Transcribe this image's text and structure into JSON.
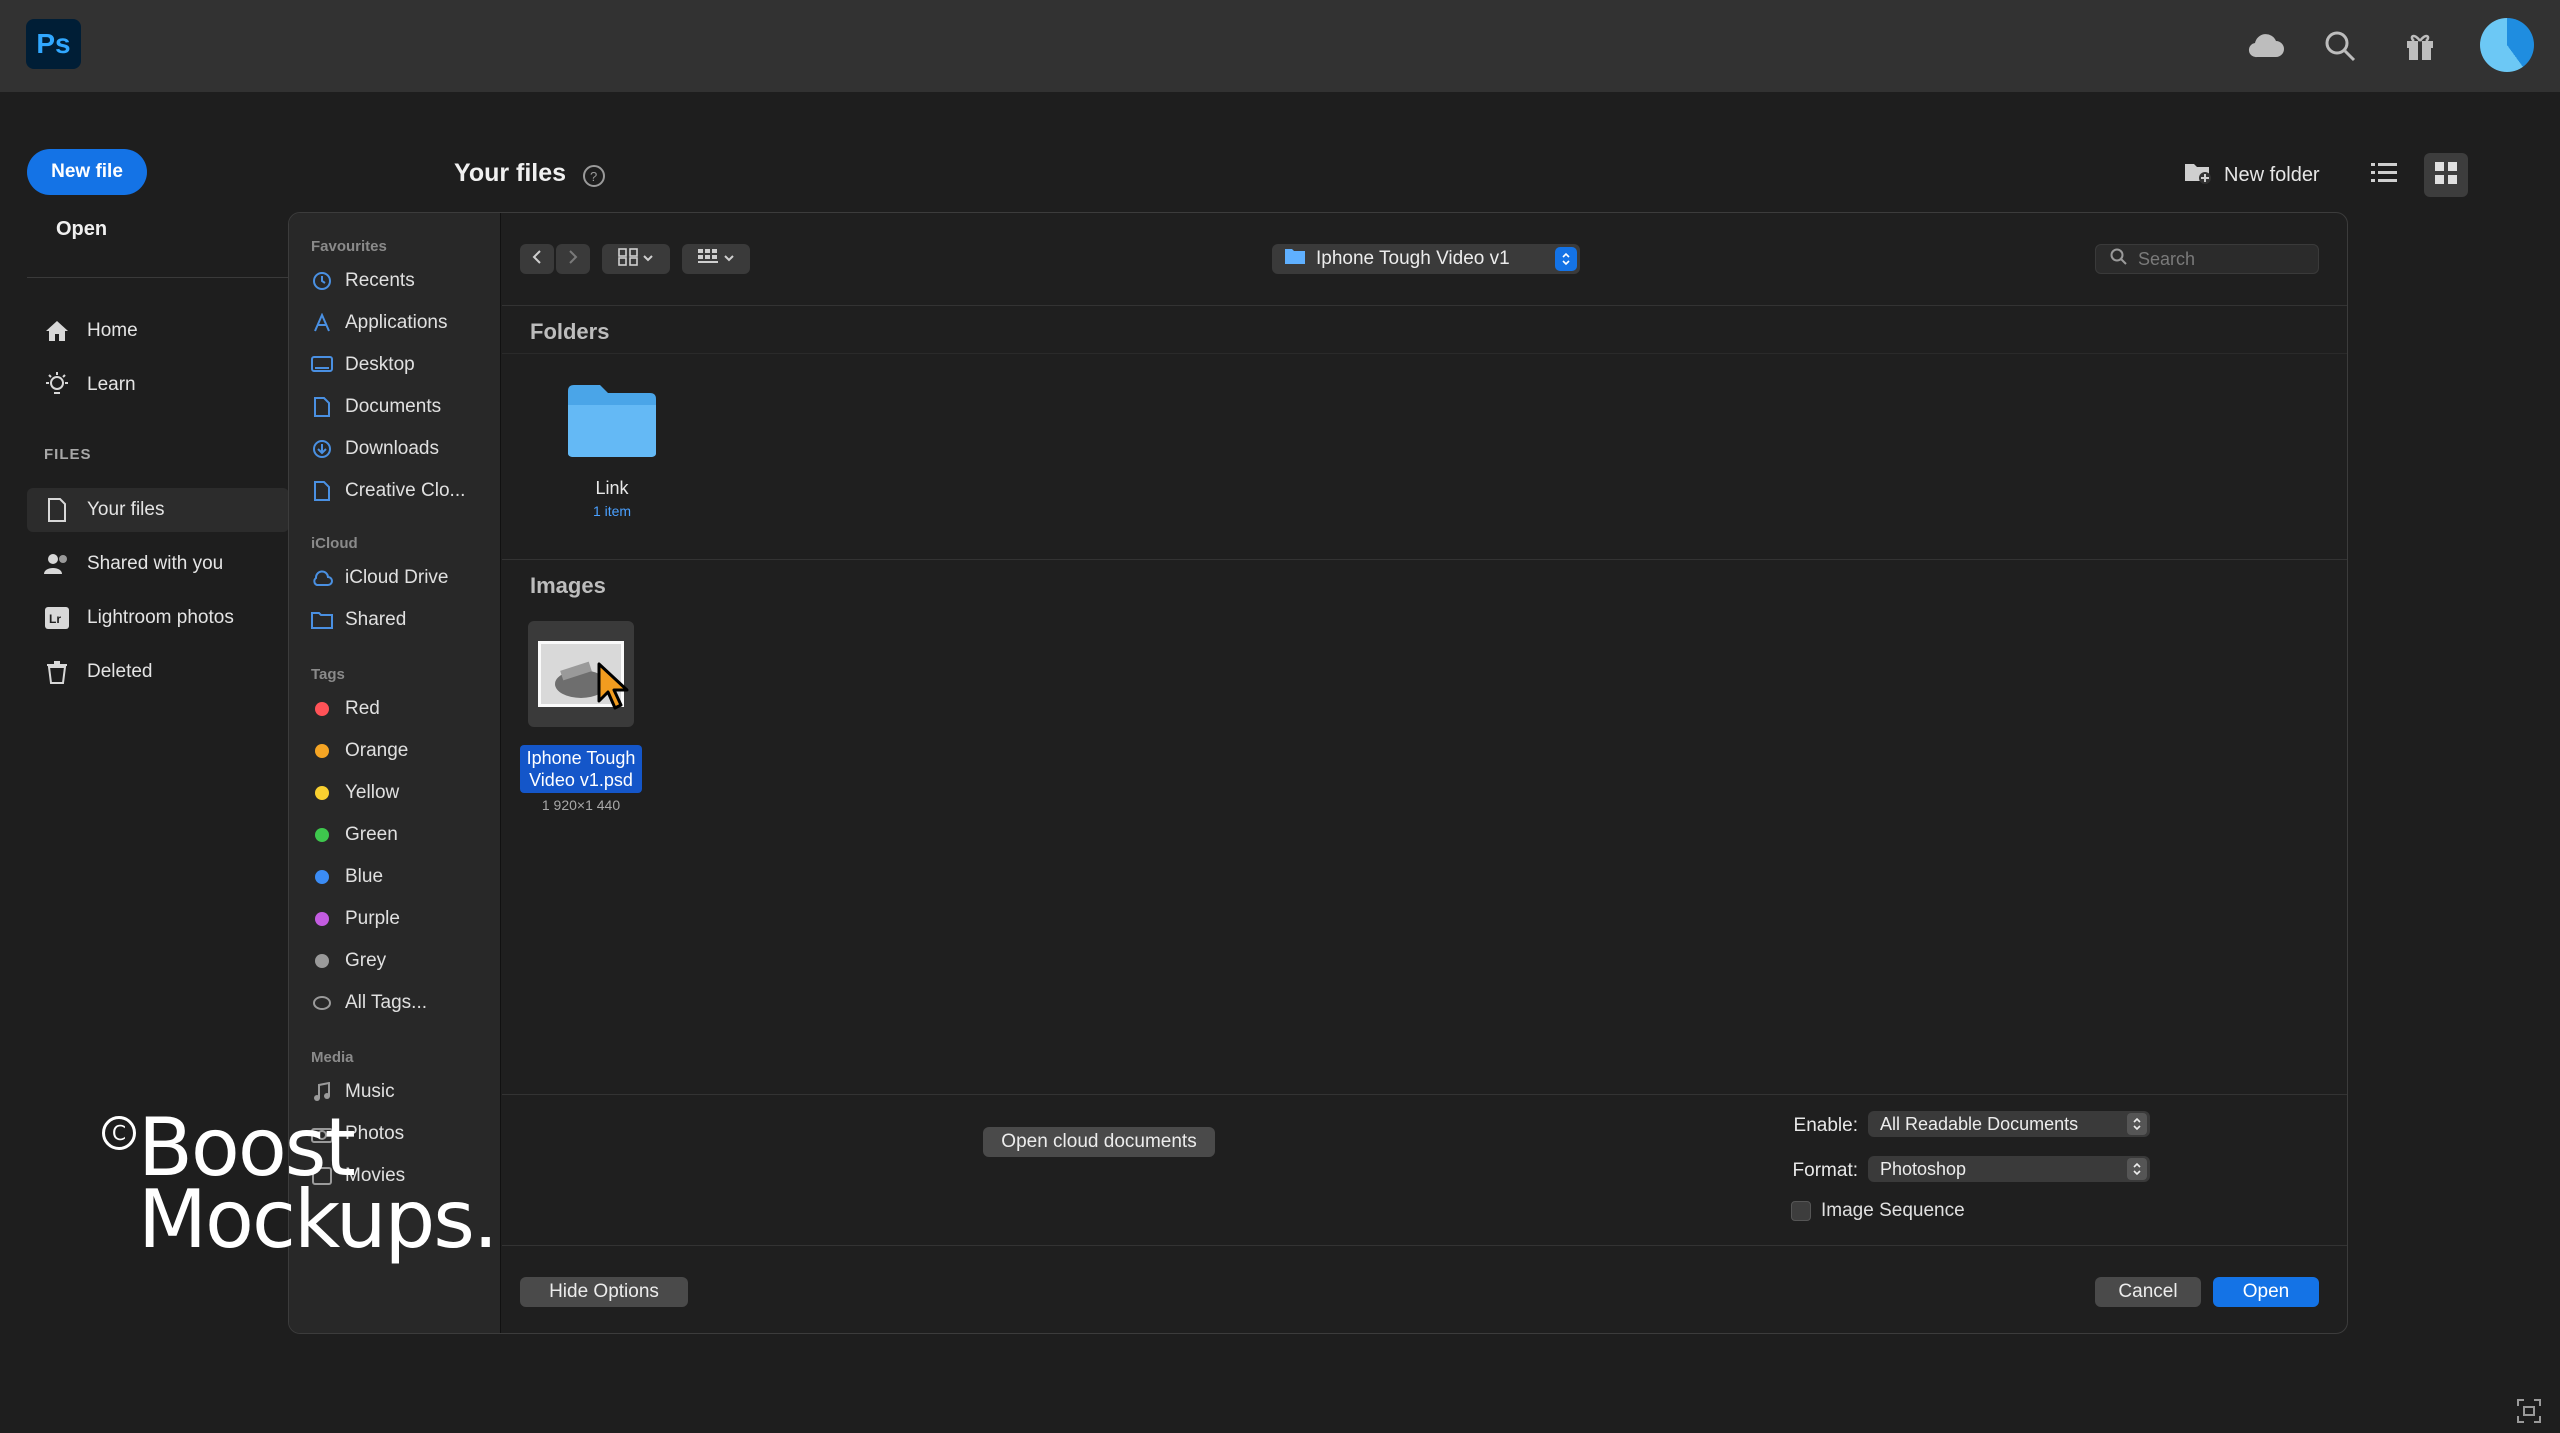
{
  "app": {
    "logo_text": "Ps",
    "brand_color": "#31a8ff",
    "accent_color": "#1473e6"
  },
  "topbar": {
    "icons": [
      "cloud-icon",
      "search-icon",
      "gift-icon",
      "avatar"
    ]
  },
  "sidebar": {
    "new_file_label": "New file",
    "open_label": "Open",
    "nav": [
      {
        "label": "Home",
        "icon": "home-icon"
      },
      {
        "label": "Learn",
        "icon": "lightbulb-icon"
      }
    ],
    "files_heading": "FILES",
    "files": [
      {
        "label": "Your files",
        "icon": "file-icon",
        "active": true
      },
      {
        "label": "Shared with you",
        "icon": "people-icon"
      },
      {
        "label": "Lightroom photos",
        "icon": "lightroom-icon"
      },
      {
        "label": "Deleted",
        "icon": "trash-icon"
      }
    ]
  },
  "header": {
    "title": "Your files",
    "new_folder_label": "New folder"
  },
  "dialog": {
    "sidebar": {
      "favourites_heading": "Favourites",
      "favourites": [
        "Recents",
        "Applications",
        "Desktop",
        "Documents",
        "Downloads",
        "Creative Clo..."
      ],
      "icloud_heading": "iCloud",
      "icloud": [
        "iCloud Drive",
        "Shared"
      ],
      "tags_heading": "Tags",
      "tags": [
        {
          "label": "Red",
          "color": "#ff5257"
        },
        {
          "label": "Orange",
          "color": "#f5a524"
        },
        {
          "label": "Yellow",
          "color": "#f9d030"
        },
        {
          "label": "Green",
          "color": "#3ec74d"
        },
        {
          "label": "Blue",
          "color": "#3b8cf5"
        },
        {
          "label": "Purple",
          "color": "#c35ce0"
        },
        {
          "label": "Grey",
          "color": "#9a9a9a"
        }
      ],
      "all_tags_label": "All Tags...",
      "media_heading": "Media",
      "media": [
        "Music",
        "Photos",
        "Movies"
      ]
    },
    "path_label": "Iphone Tough Video v1",
    "search_placeholder": "Search",
    "folders_heading": "Folders",
    "folder": {
      "name": "Link",
      "count": "1 item"
    },
    "images_heading": "Images",
    "file": {
      "name_line1": "Iphone Tough",
      "name_line2": "Video v1.psd",
      "dims": "1 920×1 440"
    },
    "open_cloud_label": "Open cloud documents",
    "enable_label": "Enable:",
    "enable_value": "All Readable Documents",
    "format_label": "Format:",
    "format_value": "Photoshop",
    "image_sequence_label": "Image Sequence",
    "hide_options_label": "Hide Options",
    "cancel_label": "Cancel",
    "open_label": "Open"
  },
  "watermark": {
    "line1": "Boost",
    "line2": "Mockups.",
    "symbol": "C"
  }
}
